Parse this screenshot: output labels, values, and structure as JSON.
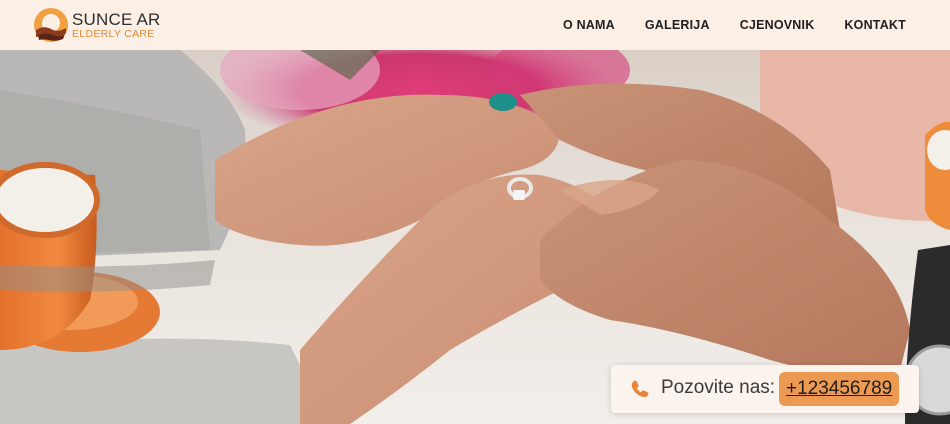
{
  "brand": {
    "name": "SUNCE AR",
    "tagline": "ELDERLY CARE",
    "logo_icon": "sun-hands-logo-icon",
    "colors": {
      "accent": "#ec9a52",
      "logo_orange": "#f0a040",
      "logo_brown": "#8b3a1e",
      "header_bg": "#fcefe6"
    }
  },
  "nav": {
    "items": [
      {
        "label": "O NAMA"
      },
      {
        "label": "GALERIJA"
      },
      {
        "label": "CJENOVNIK"
      },
      {
        "label": "KONTAKT"
      }
    ]
  },
  "hero": {
    "image": "elderly-holding-hands-photo"
  },
  "call": {
    "icon": "phone-icon",
    "label": "Pozovite nas:",
    "number": "+123456789"
  }
}
